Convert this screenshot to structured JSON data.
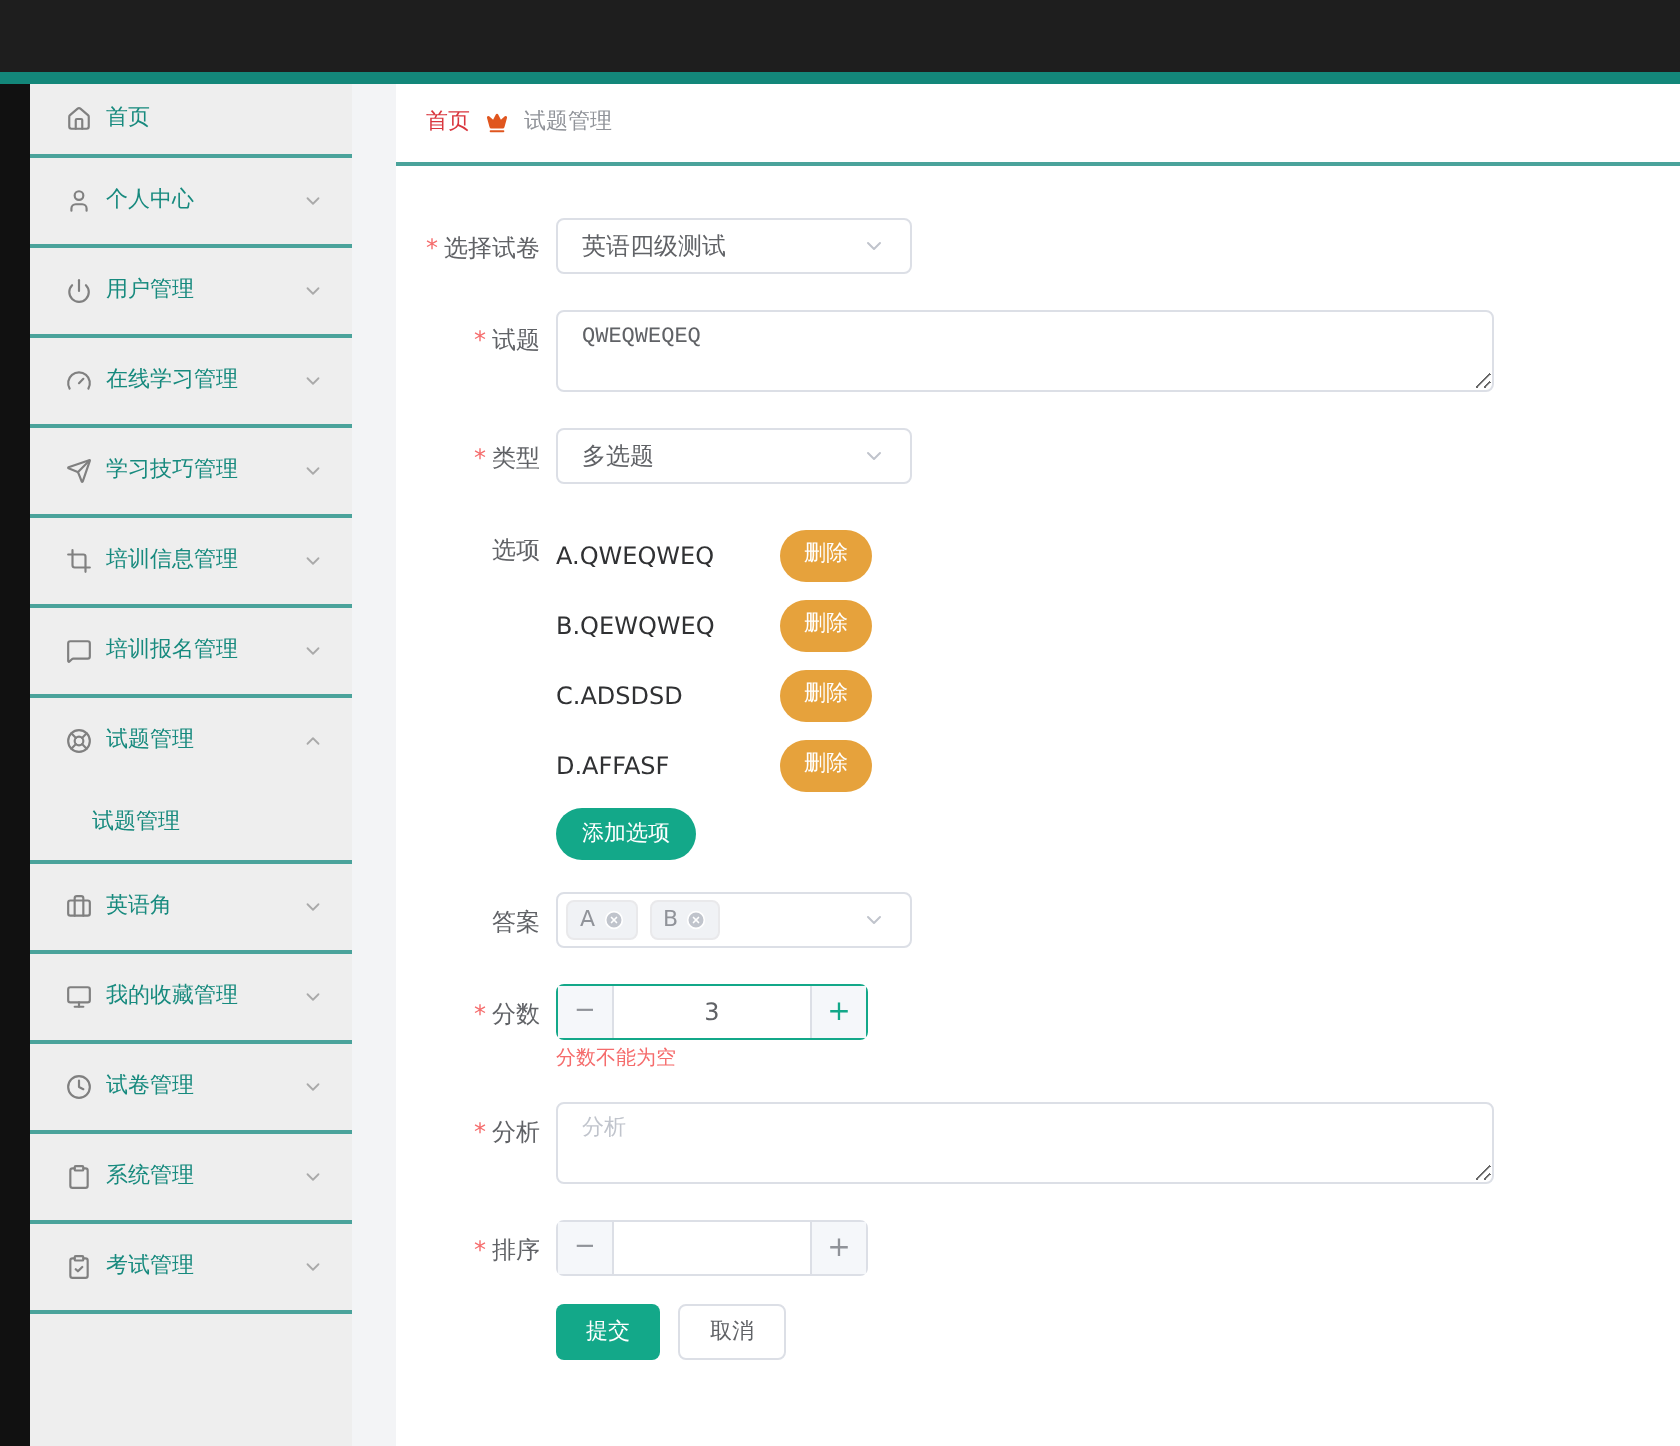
{
  "sidebar": {
    "items": [
      {
        "label": "首页"
      },
      {
        "label": "个人中心",
        "expanded": false
      },
      {
        "label": "用户管理",
        "expanded": false
      },
      {
        "label": "在线学习管理",
        "expanded": false
      },
      {
        "label": "学习技巧管理",
        "expanded": false
      },
      {
        "label": "培训信息管理",
        "expanded": false
      },
      {
        "label": "培训报名管理",
        "expanded": false
      },
      {
        "label": "试题管理",
        "expanded": true,
        "children": [
          {
            "label": "试题管理"
          }
        ]
      },
      {
        "label": "英语角",
        "expanded": false
      },
      {
        "label": "我的收藏管理",
        "expanded": false
      },
      {
        "label": "试卷管理",
        "expanded": false
      },
      {
        "label": "系统管理",
        "expanded": false
      },
      {
        "label": "考试管理",
        "expanded": false
      }
    ]
  },
  "breadcrumb": [
    {
      "label": "首页",
      "selected": false
    },
    {
      "label": "试题管理",
      "selected": true
    }
  ],
  "form": {
    "fields": [
      {
        "kind": "select",
        "label": "选择试卷",
        "required_mark": "*",
        "value": "英语四级测试"
      },
      {
        "kind": "textarea",
        "label": "试题",
        "required_mark": "*",
        "value": "QWEQWEQEQ"
      },
      {
        "kind": "select",
        "label": "类型",
        "required_mark": "*",
        "value": "多选题"
      },
      {
        "kind": "options",
        "label": "选项",
        "options": [
          {
            "text": "A.QWEQWEQ",
            "button": "删除"
          },
          {
            "text": "B.QEWQWEQ",
            "button": "删除"
          },
          {
            "text": "C.ADSDSD",
            "button": "删除"
          },
          {
            "text": "D.AFFASF",
            "button": "删除"
          }
        ],
        "add_button": "添加选项"
      },
      {
        "kind": "tags",
        "label": "答案",
        "tags": [
          "A",
          "B"
        ]
      },
      {
        "kind": "number",
        "label": "分数",
        "required_mark": "*",
        "value": "3",
        "focused": true,
        "minus": "−",
        "plus": "+",
        "error": "分数不能为空"
      },
      {
        "kind": "textarea",
        "label": "分析",
        "required_mark": "*",
        "placeholder": "分析"
      },
      {
        "kind": "number",
        "label": "排序",
        "required_mark": "*",
        "focused": false,
        "minus": "−",
        "plus": "+"
      }
    ],
    "buttons": [
      {
        "label": "提交",
        "kind": "primary"
      },
      {
        "label": "取消",
        "kind": "default"
      }
    ]
  }
}
